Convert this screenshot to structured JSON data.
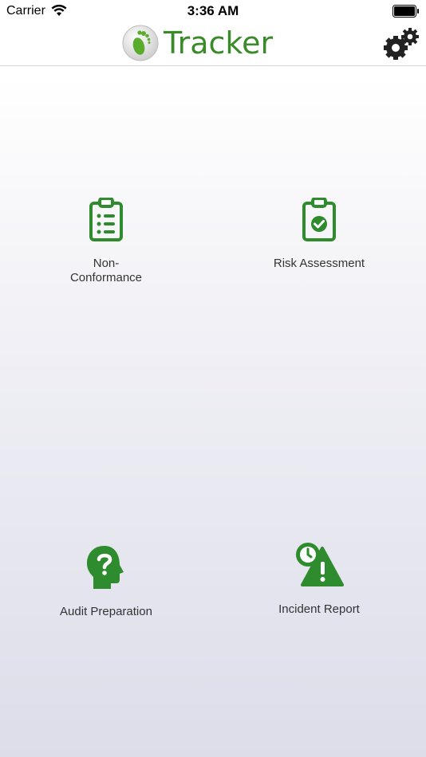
{
  "status_bar": {
    "carrier": "Carrier",
    "time": "3:36 AM"
  },
  "nav_bar": {
    "title": "Tracker",
    "settings_icon": "gears-icon",
    "brand_color": "#3a8a2a"
  },
  "tiles": [
    {
      "label": "Non-Conformance",
      "icon": "clipboard-list-icon"
    },
    {
      "label": "Risk Assessment",
      "icon": "clipboard-check-icon"
    },
    {
      "label": "Audit Preparation",
      "icon": "head-question-icon"
    },
    {
      "label": "Incident Report",
      "icon": "clock-warning-icon"
    }
  ],
  "icon_color": "#2e8b2e"
}
